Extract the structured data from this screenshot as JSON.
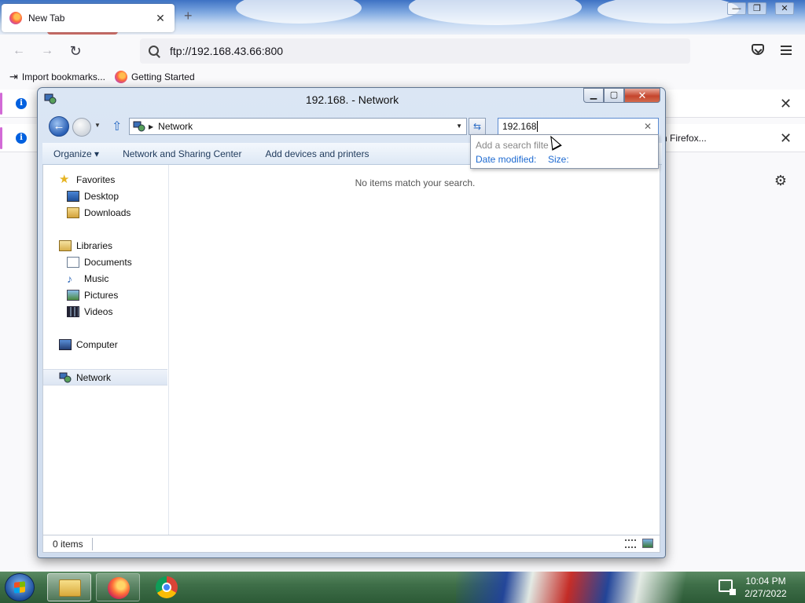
{
  "browser": {
    "tab": {
      "title": "New Tab",
      "close_icon": "close-icon"
    },
    "new_tab_label": "+",
    "window_controls": {
      "minimize": "—",
      "restore": "❐",
      "close": "✕"
    },
    "url": "ftp://192.168.43.66:800",
    "bookmarks": [
      {
        "label": "Import bookmarks...",
        "icon": "import-icon"
      },
      {
        "label": "Getting Started",
        "icon": "firefox-icon"
      }
    ],
    "infobars": [
      {
        "right_text": ""
      },
      {
        "right_text": "h Firefox..."
      }
    ]
  },
  "explorer": {
    "title": "192.168.",
    "title_suffix": " - Network",
    "address": "Network",
    "search_value": "192.168",
    "toolbar": {
      "organize": "Organize ▾",
      "network_sharing": "Network and Sharing Center",
      "add_devices": "Add devices and printers"
    },
    "search_dropdown": {
      "hint": "Add a search filte",
      "filter_date": "Date modified:",
      "filter_size": "Size:"
    },
    "nav": {
      "favorites": "Favorites",
      "desktop": "Desktop",
      "downloads": "Downloads",
      "libraries": "Libraries",
      "documents": "Documents",
      "music": "Music",
      "pictures": "Pictures",
      "videos": "Videos",
      "computer": "Computer",
      "network": "Network"
    },
    "empty_message": "No items match your search.",
    "status_count": "0 items"
  },
  "taskbar": {
    "time": "10:04 PM",
    "date": "2/27/2022"
  }
}
